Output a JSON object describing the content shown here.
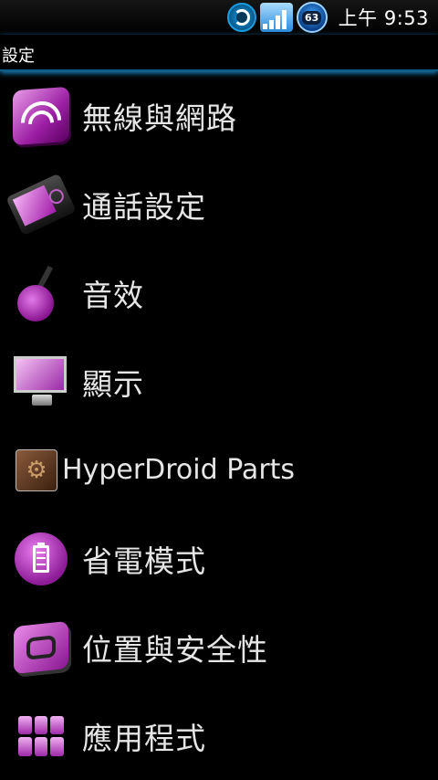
{
  "status_bar": {
    "battery_level": "63",
    "clock": "上午 9:53",
    "icons": [
      "aperture-icon",
      "signal-icon",
      "battery-icon"
    ]
  },
  "title_bar": {
    "title": "設定"
  },
  "settings_list": [
    {
      "label": "無線與網路",
      "icon": "wifi-icon"
    },
    {
      "label": "通話設定",
      "icon": "phone-icon"
    },
    {
      "label": "音效",
      "icon": "guitar-icon"
    },
    {
      "label": "顯示",
      "icon": "monitor-icon"
    },
    {
      "label": "HyperDroid Parts",
      "icon": "hyperdroid-icon"
    },
    {
      "label": "省電模式",
      "icon": "battery-saver-icon"
    },
    {
      "label": "位置與安全性",
      "icon": "lock-icon"
    },
    {
      "label": "應用程式",
      "icon": "apps-icon"
    }
  ],
  "colors": {
    "background": "#000000",
    "accent_purple": "#9b1ea3",
    "title_underline": "#1a8ccc"
  }
}
